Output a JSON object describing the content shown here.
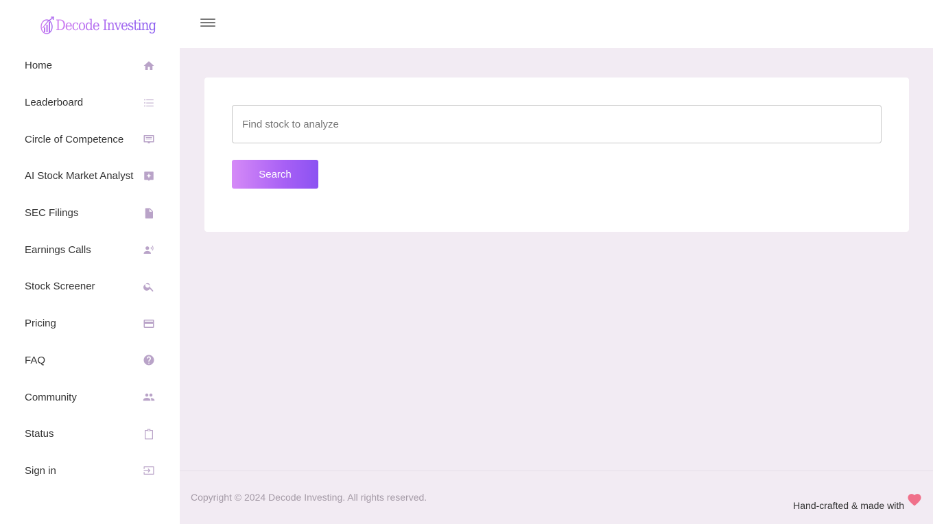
{
  "brand": {
    "name": "Decode Investing",
    "gradient_start": "#d07cf0",
    "gradient_end": "#8a5cf0"
  },
  "sidebar": {
    "items": [
      {
        "label": "Home",
        "icon": "home-icon"
      },
      {
        "label": "Leaderboard",
        "icon": "list-numbered-icon"
      },
      {
        "label": "Circle of Competence",
        "icon": "monitor-list-icon"
      },
      {
        "label": "AI Stock Market Analyst",
        "icon": "sparkle-chat-icon"
      },
      {
        "label": "SEC Filings",
        "icon": "document-icon"
      },
      {
        "label": "Earnings Calls",
        "icon": "person-speaking-icon"
      },
      {
        "label": "Stock Screener",
        "icon": "search-icon"
      },
      {
        "label": "Pricing",
        "icon": "credit-card-icon"
      },
      {
        "label": "FAQ",
        "icon": "help-circle-icon"
      },
      {
        "label": "Community",
        "icon": "people-icon"
      },
      {
        "label": "Status",
        "icon": "clipboard-icon"
      },
      {
        "label": "Sign in",
        "icon": "sign-in-icon"
      }
    ]
  },
  "header": {
    "menu_icon": "hamburger-icon"
  },
  "search": {
    "placeholder": "Find stock to analyze",
    "value": "",
    "button_label": "Search",
    "button_gradient": [
      "#d58af7",
      "#8b52f2"
    ]
  },
  "footer": {
    "copyright": "Copyright © 2024 Decode Investing. All rights reserved.",
    "handcrafted": "Hand-crafted & made with",
    "heart_color": "#f0708a"
  },
  "colors": {
    "main_bg": "#f2ebf3",
    "icon": "#b9a3c8"
  }
}
